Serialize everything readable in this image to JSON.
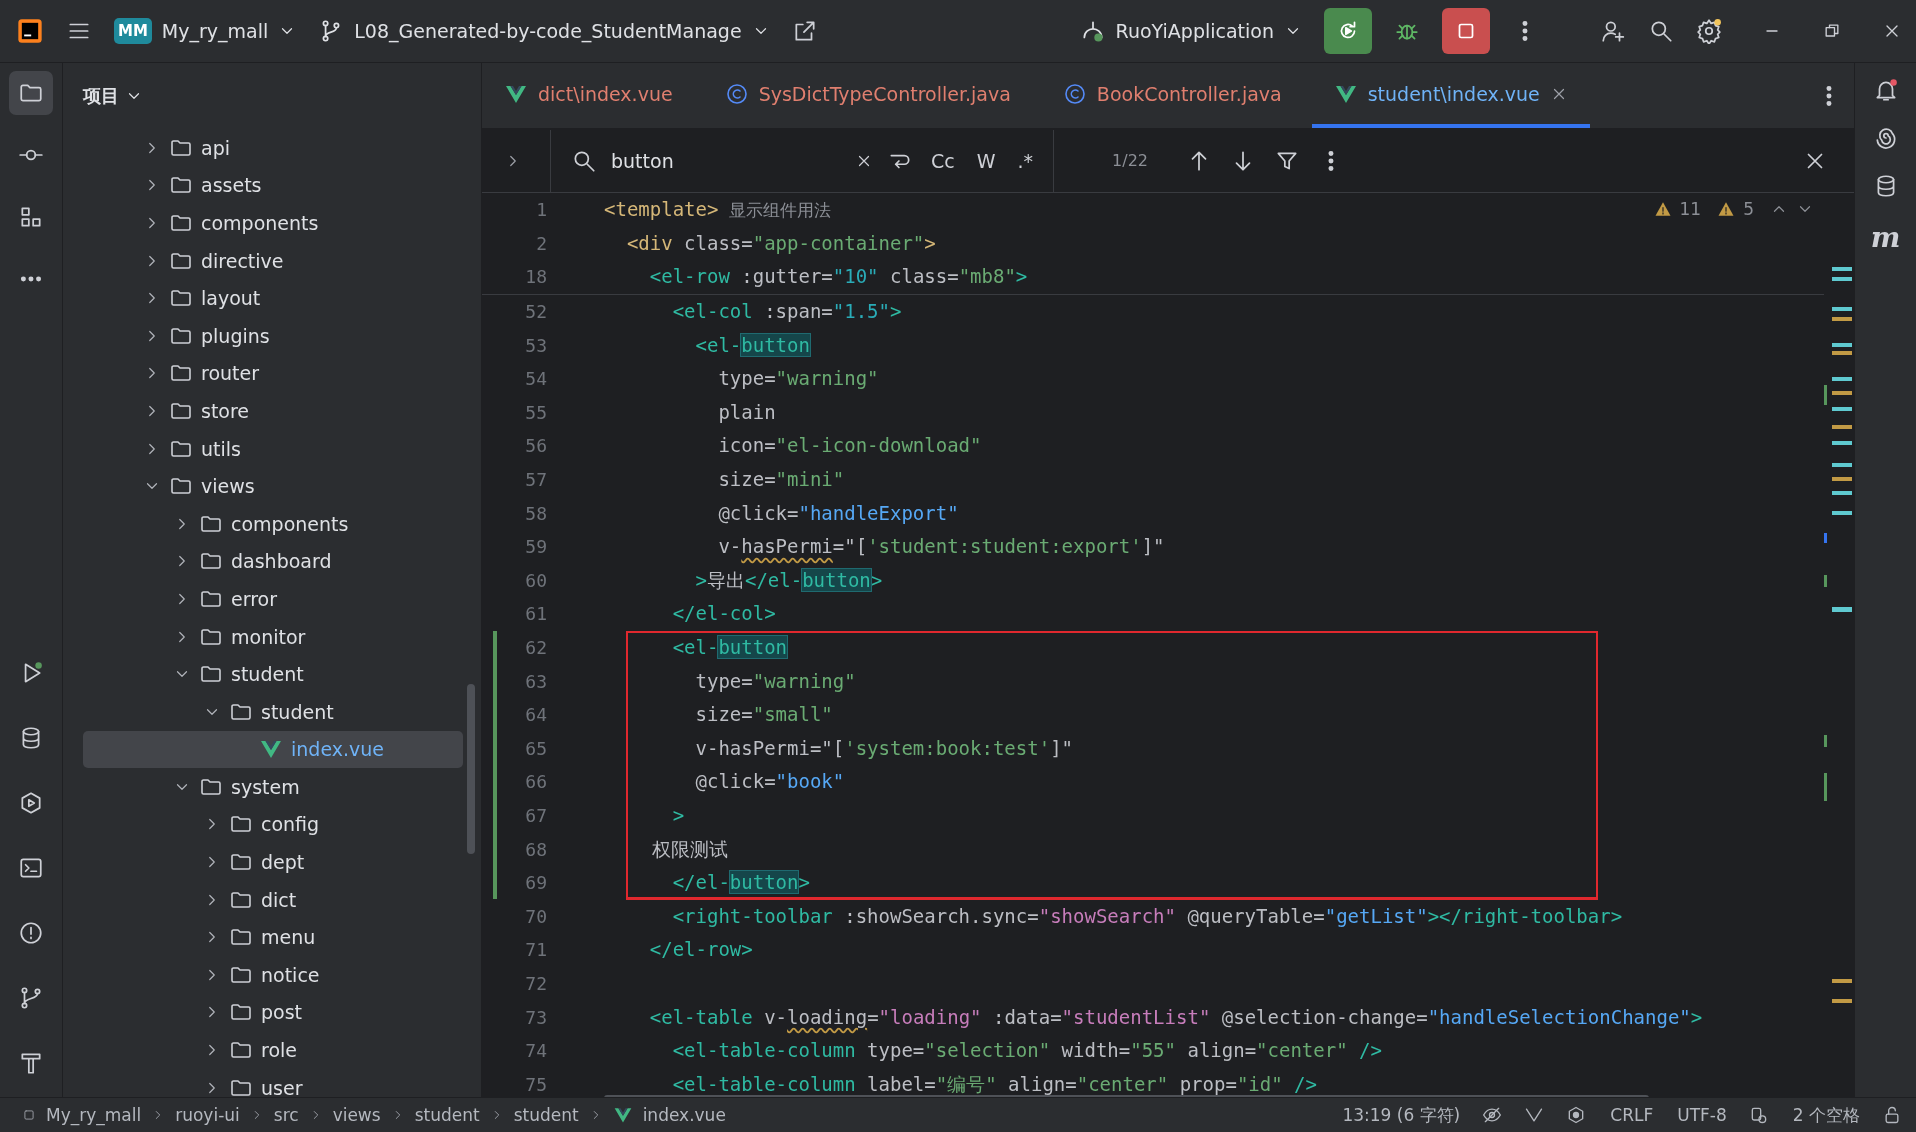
{
  "topbar": {
    "project_badge": "MM",
    "project": "My_ry_mall",
    "branch": "L08_Generated-by-code_StudentManage",
    "run_config": "RuoYiApplication"
  },
  "left_toolbar": [
    {
      "kind": "folder",
      "selected": true
    },
    {
      "kind": "commit",
      "selected": false
    },
    {
      "kind": "structure",
      "selected": false
    },
    {
      "kind": "more",
      "selected": false
    },
    {
      "kind": "run",
      "selected": false
    },
    {
      "kind": "database",
      "selected": false
    },
    {
      "kind": "services",
      "selected": false
    },
    {
      "kind": "terminal",
      "selected": false
    },
    {
      "kind": "problems",
      "selected": false
    },
    {
      "kind": "git",
      "selected": false
    },
    {
      "kind": "build",
      "selected": false
    }
  ],
  "project_panel": {
    "title": "项目",
    "tree": [
      {
        "name": "api",
        "kind": "folder",
        "expanded": false,
        "selected": false
      },
      {
        "name": "assets",
        "kind": "folder",
        "expanded": false,
        "selected": false
      },
      {
        "name": "components",
        "kind": "folder",
        "expanded": false,
        "selected": false
      },
      {
        "name": "directive",
        "kind": "folder",
        "expanded": false,
        "selected": false
      },
      {
        "name": "layout",
        "kind": "folder",
        "expanded": false,
        "selected": false
      },
      {
        "name": "plugins",
        "kind": "folder",
        "expanded": false,
        "selected": false
      },
      {
        "name": "router",
        "kind": "folder",
        "expanded": false,
        "selected": false
      },
      {
        "name": "store",
        "kind": "folder",
        "expanded": false,
        "selected": false
      },
      {
        "name": "utils",
        "kind": "folder",
        "expanded": false,
        "selected": false
      },
      {
        "name": "views",
        "kind": "folder",
        "expanded": true,
        "selected": false,
        "children": [
          {
            "name": "components",
            "kind": "folder",
            "expanded": false,
            "selected": false
          },
          {
            "name": "dashboard",
            "kind": "folder",
            "expanded": false,
            "selected": false
          },
          {
            "name": "error",
            "kind": "folder",
            "expanded": false,
            "selected": false
          },
          {
            "name": "monitor",
            "kind": "folder",
            "expanded": false,
            "selected": false
          },
          {
            "name": "student",
            "kind": "folder",
            "expanded": true,
            "selected": false,
            "children": [
              {
                "name": "student",
                "kind": "folder",
                "expanded": true,
                "selected": false,
                "children": [
                  {
                    "name": "index.vue",
                    "kind": "vue",
                    "selected": true
                  }
                ]
              }
            ]
          },
          {
            "name": "system",
            "kind": "folder",
            "expanded": true,
            "selected": false,
            "children": [
              {
                "name": "config",
                "kind": "folder",
                "expanded": false,
                "selected": false
              },
              {
                "name": "dept",
                "kind": "folder",
                "expanded": false,
                "selected": false
              },
              {
                "name": "dict",
                "kind": "folder",
                "expanded": false,
                "selected": false
              },
              {
                "name": "menu",
                "kind": "folder",
                "expanded": false,
                "selected": false
              },
              {
                "name": "notice",
                "kind": "folder",
                "expanded": false,
                "selected": false
              },
              {
                "name": "post",
                "kind": "folder",
                "expanded": false,
                "selected": false
              },
              {
                "name": "role",
                "kind": "folder",
                "expanded": false,
                "selected": false
              },
              {
                "name": "user",
                "kind": "folder",
                "expanded": false,
                "selected": false
              }
            ]
          }
        ]
      }
    ]
  },
  "tabs": [
    {
      "label": "dict\\index.vue",
      "kind": "vue",
      "selected": false
    },
    {
      "label": "SysDictTypeController.java",
      "kind": "java",
      "selected": false
    },
    {
      "label": "BookController.java",
      "kind": "java",
      "selected": false
    },
    {
      "label": "student\\index.vue",
      "kind": "vue",
      "selected": true
    }
  ],
  "search": {
    "value": "button",
    "match_case": "Cc",
    "words": "W",
    "regex": ".*",
    "count": "1/22"
  },
  "inspections": {
    "warnings": "11",
    "weak_warnings": "5"
  },
  "sticky_lines": [
    {
      "num": "1",
      "tokens": [
        {
          "kind": "tag",
          "text": "<template>"
        },
        {
          "kind": "hint",
          "text": "  显示组件用法"
        }
      ]
    },
    {
      "num": "2",
      "tokens": [
        {
          "kind": "tag",
          "text": "  <div"
        },
        {
          "kind": "attr",
          "text": " class="
        },
        {
          "kind": "str",
          "text": "\"app-container\""
        },
        {
          "kind": "tag",
          "text": ">"
        }
      ]
    },
    {
      "num": "18",
      "tokens": [
        {
          "kind": "comp",
          "text": "    <el-row"
        },
        {
          "kind": "attr",
          "text": " :gutter="
        },
        {
          "kind": "num",
          "text": "\"10\""
        },
        {
          "kind": "attr",
          "text": " class="
        },
        {
          "kind": "str",
          "text": "\"mb8\""
        },
        {
          "kind": "comp",
          "text": ">"
        }
      ]
    }
  ],
  "lines": [
    {
      "num": "52",
      "boxed": false,
      "changed": false,
      "tokens": [
        {
          "kind": "comp",
          "text": "      <el-col"
        },
        {
          "kind": "attr",
          "text": " :span="
        },
        {
          "kind": "num",
          "text": "\"1.5\""
        },
        {
          "kind": "comp",
          "text": ">"
        }
      ]
    },
    {
      "num": "53",
      "boxed": false,
      "changed": false,
      "tokens": [
        {
          "kind": "comp",
          "text": "        <el-"
        },
        {
          "kind": "match",
          "text": "button"
        }
      ]
    },
    {
      "num": "54",
      "boxed": false,
      "changed": false,
      "tokens": [
        {
          "kind": "attr",
          "text": "          type="
        },
        {
          "kind": "str",
          "text": "\"warning\""
        }
      ]
    },
    {
      "num": "55",
      "boxed": false,
      "changed": false,
      "tokens": [
        {
          "kind": "attr",
          "text": "          plain"
        }
      ]
    },
    {
      "num": "56",
      "boxed": false,
      "changed": false,
      "tokens": [
        {
          "kind": "attr",
          "text": "          icon="
        },
        {
          "kind": "str",
          "text": "\"el-icon-download\""
        }
      ]
    },
    {
      "num": "57",
      "boxed": false,
      "changed": false,
      "tokens": [
        {
          "kind": "attr",
          "text": "          size="
        },
        {
          "kind": "str",
          "text": "\"mini\""
        }
      ]
    },
    {
      "num": "58",
      "boxed": false,
      "changed": false,
      "tokens": [
        {
          "kind": "attr",
          "text": "          @click="
        },
        {
          "kind": "fn",
          "text": "\"handleExport\""
        }
      ]
    },
    {
      "num": "59",
      "boxed": false,
      "changed": false,
      "tokens": [
        {
          "kind": "attr",
          "text": "          v-"
        },
        {
          "kind": "warn",
          "text": "hasPermi"
        },
        {
          "kind": "attr",
          "text": "=\"["
        },
        {
          "kind": "str",
          "text": "'student:student:export'"
        },
        {
          "kind": "attr",
          "text": "]\""
        }
      ]
    },
    {
      "num": "60",
      "boxed": false,
      "changed": false,
      "tokens": [
        {
          "kind": "comp",
          "text": "        >"
        },
        {
          "kind": "text",
          "text": "导出"
        },
        {
          "kind": "comp",
          "text": "</el-"
        },
        {
          "kind": "match",
          "text": "button"
        },
        {
          "kind": "comp",
          "text": ">"
        }
      ]
    },
    {
      "num": "61",
      "boxed": false,
      "changed": false,
      "tokens": [
        {
          "kind": "comp",
          "text": "      </el-col>"
        }
      ]
    },
    {
      "num": "62",
      "boxed": true,
      "changed": true,
      "tokens": [
        {
          "kind": "comp",
          "text": "      <el-"
        },
        {
          "kind": "match",
          "text": "button"
        }
      ]
    },
    {
      "num": "63",
      "boxed": true,
      "changed": true,
      "tokens": [
        {
          "kind": "attr",
          "text": "        type="
        },
        {
          "kind": "str",
          "text": "\"warning\""
        }
      ]
    },
    {
      "num": "64",
      "boxed": true,
      "changed": true,
      "tokens": [
        {
          "kind": "attr",
          "text": "        size="
        },
        {
          "kind": "str",
          "text": "\"small\""
        }
      ]
    },
    {
      "num": "65",
      "boxed": true,
      "changed": true,
      "tokens": [
        {
          "kind": "attr",
          "text": "        v-hasPermi=\"["
        },
        {
          "kind": "str",
          "text": "'system:book:test'"
        },
        {
          "kind": "attr",
          "text": "]\""
        }
      ]
    },
    {
      "num": "66",
      "boxed": true,
      "changed": true,
      "tokens": [
        {
          "kind": "attr",
          "text": "        @click="
        },
        {
          "kind": "fn",
          "text": "\"book\""
        }
      ]
    },
    {
      "num": "67",
      "boxed": true,
      "changed": true,
      "tokens": [
        {
          "kind": "comp",
          "text": "      >"
        }
      ]
    },
    {
      "num": "68",
      "boxed": true,
      "changed": true,
      "tokens": [
        {
          "kind": "text",
          "text": "        权限测试"
        }
      ]
    },
    {
      "num": "69",
      "boxed": true,
      "changed": true,
      "tokens": [
        {
          "kind": "comp",
          "text": "      </el-"
        },
        {
          "kind": "match",
          "text": "button"
        },
        {
          "kind": "comp",
          "text": ">"
        }
      ]
    },
    {
      "num": "70",
      "boxed": false,
      "changed": false,
      "tokens": [
        {
          "kind": "comp",
          "text": "      <right-toolbar"
        },
        {
          "kind": "attr",
          "text": " :showSearch.sync="
        },
        {
          "kind": "expr",
          "text": "\"showSearch\""
        },
        {
          "kind": "attr",
          "text": " @queryTable="
        },
        {
          "kind": "fn",
          "text": "\"getList\""
        },
        {
          "kind": "comp",
          "text": "></right-toolbar>"
        }
      ]
    },
    {
      "num": "71",
      "boxed": false,
      "changed": false,
      "tokens": [
        {
          "kind": "comp",
          "text": "    </el-row>"
        }
      ]
    },
    {
      "num": "72",
      "boxed": false,
      "changed": false
    },
    {
      "num": "73",
      "boxed": false,
      "changed": false,
      "tokens": [
        {
          "kind": "comp",
          "text": "    <el-table"
        },
        {
          "kind": "attr",
          "text": " v-"
        },
        {
          "kind": "warn",
          "text": "loading"
        },
        {
          "kind": "attr",
          "text": "="
        },
        {
          "kind": "expr",
          "text": "\"loading\""
        },
        {
          "kind": "attr",
          "text": " :data="
        },
        {
          "kind": "expr",
          "text": "\"studentList\""
        },
        {
          "kind": "attr",
          "text": " @selection-change="
        },
        {
          "kind": "fn",
          "text": "\"handleSelectionChange\""
        },
        {
          "kind": "comp",
          "text": ">"
        }
      ]
    },
    {
      "num": "74",
      "boxed": false,
      "changed": false,
      "tokens": [
        {
          "kind": "comp",
          "text": "      <el-table-column"
        },
        {
          "kind": "attr",
          "text": " type="
        },
        {
          "kind": "str",
          "text": "\"selection\""
        },
        {
          "kind": "attr",
          "text": " width="
        },
        {
          "kind": "str",
          "text": "\"55\""
        },
        {
          "kind": "attr",
          "text": " align="
        },
        {
          "kind": "str",
          "text": "\"center\""
        },
        {
          "kind": "comp",
          "text": " />"
        }
      ]
    },
    {
      "num": "75",
      "boxed": false,
      "changed": false,
      "tokens": [
        {
          "kind": "comp",
          "text": "      <el-table-column"
        },
        {
          "kind": "attr",
          "text": " label="
        },
        {
          "kind": "str",
          "text": "\"编号\""
        },
        {
          "kind": "attr",
          "text": " align="
        },
        {
          "kind": "str",
          "text": "\"center\""
        },
        {
          "kind": "attr",
          "text": " prop="
        },
        {
          "kind": "str",
          "text": "\"id\""
        },
        {
          "kind": "comp",
          "text": " />"
        }
      ]
    }
  ],
  "right_toolbar": {
    "maven_label": "m"
  },
  "status_bar": {
    "breadcrumbs": [
      {
        "label": "My_ry_mall",
        "kind": "module"
      },
      {
        "label": "ruoyi-ui",
        "kind": "dir"
      },
      {
        "label": "src",
        "kind": "dir"
      },
      {
        "label": "views",
        "kind": "dir"
      },
      {
        "label": "student",
        "kind": "dir"
      },
      {
        "label": "student",
        "kind": "dir"
      },
      {
        "label": "index.vue",
        "kind": "vue"
      }
    ],
    "position": "13:19 (6 字符)",
    "line_separator": "CRLF",
    "encoding": "UTF-8",
    "indent": "2 个空格"
  }
}
